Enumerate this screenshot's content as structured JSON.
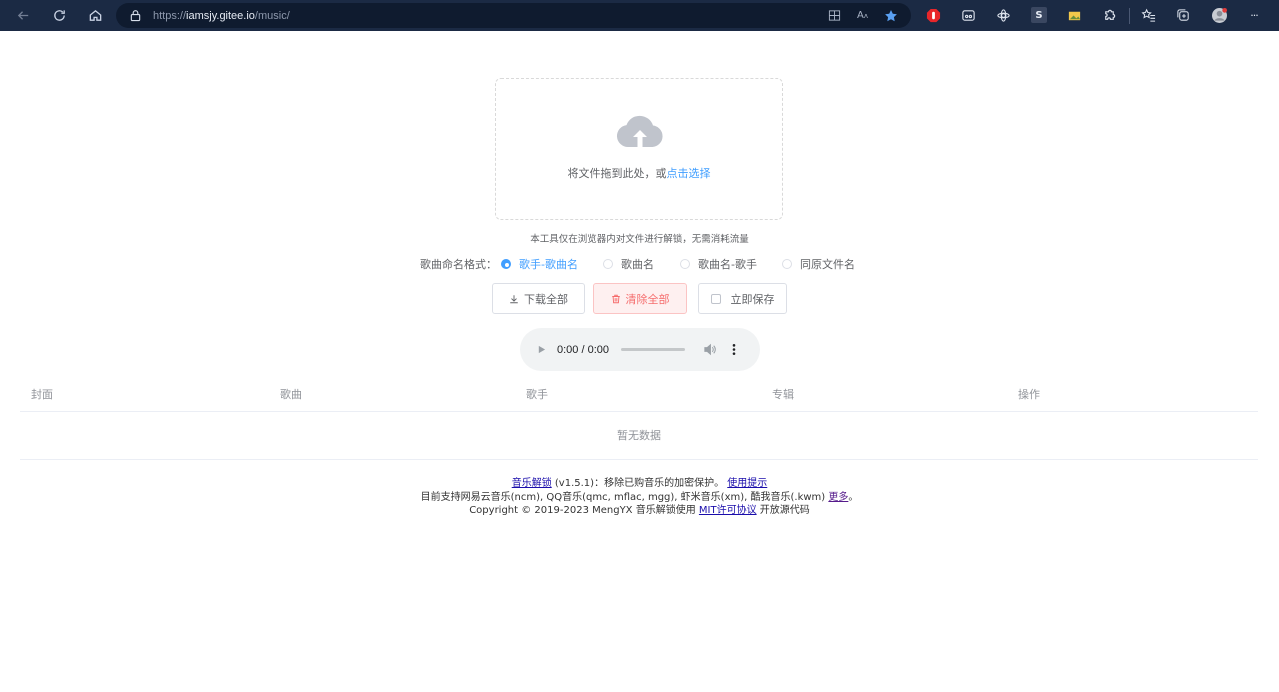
{
  "browser": {
    "url_prefix": "https://",
    "url_host": "iamsjy.gitee.io",
    "url_path": "/music/",
    "tab_icon_text": "S",
    "more_label": "···"
  },
  "upload": {
    "hint_text": "将文件拖到此处，或",
    "hint_link": "点击选择"
  },
  "note": "本工具仅在浏览器内对文件进行解锁，无需消耗流量",
  "naming": {
    "label": "歌曲命名格式：",
    "options": [
      {
        "label": "歌手-歌曲名",
        "checked": true
      },
      {
        "label": "歌曲名",
        "checked": false
      },
      {
        "label": "歌曲名-歌手",
        "checked": false
      },
      {
        "label": "同原文件名",
        "checked": false
      }
    ]
  },
  "buttons": {
    "download_all": "下载全部",
    "clear_all": "清除全部",
    "save_now": "立即保存"
  },
  "player": {
    "time": "0:00 / 0:00"
  },
  "table": {
    "columns": [
      "封面",
      "歌曲",
      "歌手",
      "专辑",
      "操作"
    ],
    "empty_text": "暂无数据"
  },
  "footer": {
    "line1_link": "音乐解锁",
    "line1_version": "(v1.5.1)：移除已购音乐的加密保护。",
    "line1_help": "使用提示",
    "line2_text": "目前支持网易云音乐(ncm), QQ音乐(qmc, mflac, mgg), 虾米音乐(xm), 酷我音乐(.kwm)",
    "line2_more": "更多",
    "line2_end": "。",
    "line3_text": "Copyright © 2019-2023 MengYX 音乐解锁使用",
    "line3_license": "MIT许可协议",
    "line3_end": "开放源代码"
  }
}
